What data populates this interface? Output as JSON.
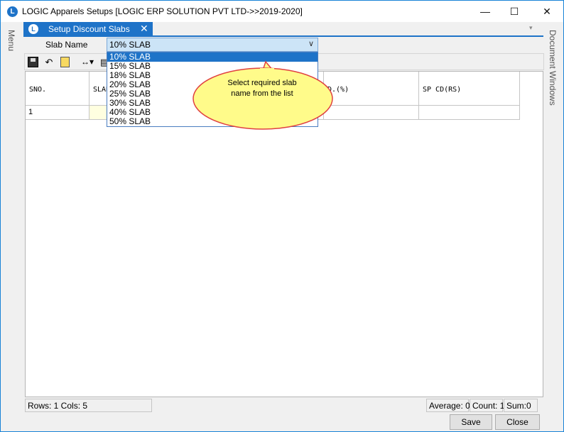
{
  "window": {
    "title": "LOGIC Apparels Setups  [LOGIC ERP SOLUTION PVT LTD->>2019-2020]",
    "app_icon_glyph": "L",
    "minimize_glyph": "—",
    "maximize_glyph": "☐",
    "close_glyph": "✕"
  },
  "rails": {
    "left_label": "Menu",
    "right_label": "Document Windows"
  },
  "tab": {
    "label": "Setup Discount Slabs",
    "icon_glyph": "L",
    "close_glyph": "✕",
    "overflow_glyph": "▾"
  },
  "form": {
    "slab_name_label": "Slab Name",
    "slab_name_value": "10% SLAB",
    "chevron_glyph": "∨"
  },
  "toolbar": {
    "undo_glyph": "↶",
    "resize_glyph": "↔▾",
    "grid_glyph": "▤"
  },
  "dropdown": {
    "options": [
      "10% SLAB",
      "15% SLAB",
      "18% SLAB",
      "20% SLAB",
      "25% SLAB",
      "30% SLAB",
      "40% SLAB",
      "50% SLAB"
    ],
    "selected": "10% SLAB"
  },
  "callout": {
    "line1": "Select  required  slab",
    "line2": "name  from  the  list"
  },
  "grid": {
    "columns": [
      "SNO.",
      "SLAB",
      "",
      "D.(%)",
      "SP CD(RS)"
    ],
    "rows": [
      [
        "1",
        "",
        "",
        "",
        ""
      ]
    ]
  },
  "status": {
    "rows_cols": "Rows: 1  Cols: 5",
    "average": "Average: 0",
    "count": "Count: 1",
    "sum": "Sum:0"
  },
  "buttons": {
    "save": "Save",
    "close": "Close"
  },
  "colors": {
    "accent": "#1e73c8",
    "callout_fill": "#fffb8a",
    "callout_stroke": "#e04040",
    "selected_row": "#1e73c8"
  }
}
